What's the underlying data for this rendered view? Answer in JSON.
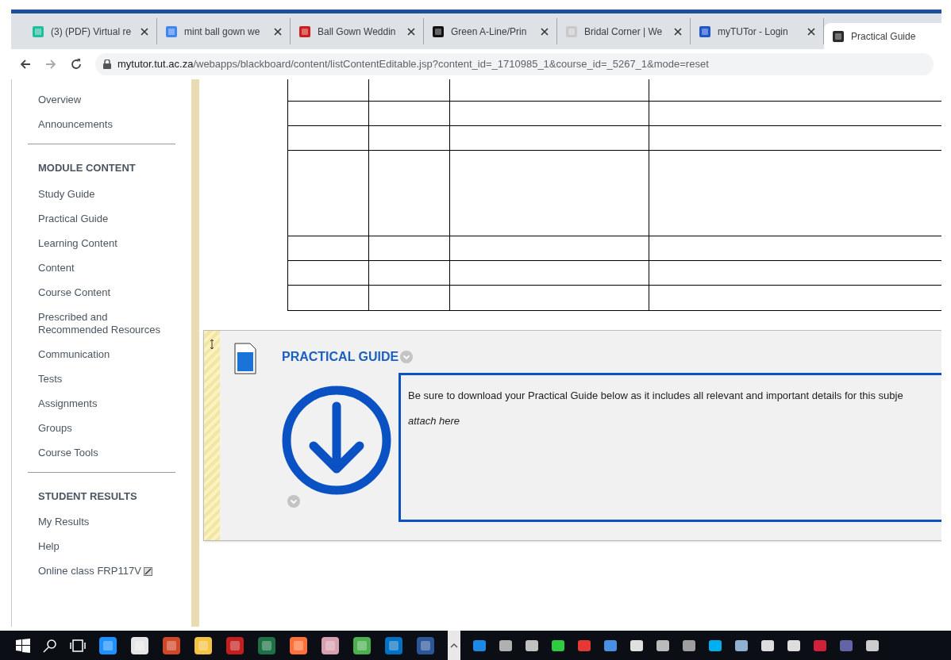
{
  "browser": {
    "tabs": [
      {
        "title": "(3) (PDF) Virtual re",
        "color": "#1fbf9f",
        "selected": false
      },
      {
        "title": "mint ball gown we",
        "color": "#4285f4",
        "selected": false
      },
      {
        "title": "Ball Gown Weddin",
        "color": "#d01c1c",
        "selected": false
      },
      {
        "title": "Green A-Line/Prin",
        "color": "#111111",
        "selected": false
      },
      {
        "title": "Bridal Corner | We",
        "color": "#c8c8c8",
        "selected": false
      },
      {
        "title": "myTUTor - Login",
        "color": "#2255cc",
        "selected": false
      },
      {
        "title": "Practical Guide",
        "color": "#2b2b2b",
        "selected": true
      }
    ],
    "url_host": "mytutor.tut.ac.za",
    "url_path": "/webapps/blackboard/content/listContentEditable.jsp?content_id=_1710985_1&course_id=_5267_1&mode=reset"
  },
  "sidebar": {
    "sections": [
      {
        "items": [
          "Overview",
          "Announcements"
        ]
      },
      {
        "heading": "MODULE CONTENT",
        "items": [
          "Study Guide",
          "Practical Guide",
          "Learning Content",
          "Content",
          "Course Content",
          "Prescribed and Recommended Resources",
          "Communication",
          "Tests",
          "Assignments",
          "Groups",
          "Course Tools"
        ]
      },
      {
        "heading": "STUDENT RESULTS",
        "items": [
          "My Results",
          "Help",
          "Online class FRP117V"
        ]
      }
    ]
  },
  "content_item": {
    "title": "PRACTICAL GUIDE",
    "description": "Be sure to download your Practical Guide below as it includes all relevant and important details for this subje",
    "note": "attach here"
  }
}
